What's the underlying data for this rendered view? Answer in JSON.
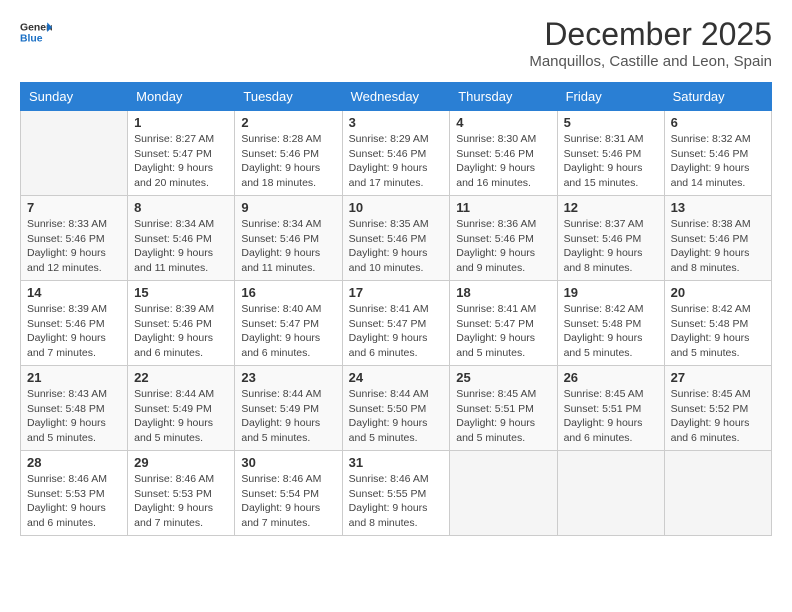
{
  "logo": {
    "general": "General",
    "blue": "Blue"
  },
  "title": "December 2025",
  "subtitle": "Manquillos, Castille and Leon, Spain",
  "days_of_week": [
    "Sunday",
    "Monday",
    "Tuesday",
    "Wednesday",
    "Thursday",
    "Friday",
    "Saturday"
  ],
  "weeks": [
    [
      {
        "day": "",
        "sunrise": "",
        "sunset": "",
        "daylight": ""
      },
      {
        "day": "1",
        "sunrise": "Sunrise: 8:27 AM",
        "sunset": "Sunset: 5:47 PM",
        "daylight": "Daylight: 9 hours and 20 minutes."
      },
      {
        "day": "2",
        "sunrise": "Sunrise: 8:28 AM",
        "sunset": "Sunset: 5:46 PM",
        "daylight": "Daylight: 9 hours and 18 minutes."
      },
      {
        "day": "3",
        "sunrise": "Sunrise: 8:29 AM",
        "sunset": "Sunset: 5:46 PM",
        "daylight": "Daylight: 9 hours and 17 minutes."
      },
      {
        "day": "4",
        "sunrise": "Sunrise: 8:30 AM",
        "sunset": "Sunset: 5:46 PM",
        "daylight": "Daylight: 9 hours and 16 minutes."
      },
      {
        "day": "5",
        "sunrise": "Sunrise: 8:31 AM",
        "sunset": "Sunset: 5:46 PM",
        "daylight": "Daylight: 9 hours and 15 minutes."
      },
      {
        "day": "6",
        "sunrise": "Sunrise: 8:32 AM",
        "sunset": "Sunset: 5:46 PM",
        "daylight": "Daylight: 9 hours and 14 minutes."
      }
    ],
    [
      {
        "day": "7",
        "sunrise": "Sunrise: 8:33 AM",
        "sunset": "Sunset: 5:46 PM",
        "daylight": "Daylight: 9 hours and 12 minutes."
      },
      {
        "day": "8",
        "sunrise": "Sunrise: 8:34 AM",
        "sunset": "Sunset: 5:46 PM",
        "daylight": "Daylight: 9 hours and 11 minutes."
      },
      {
        "day": "9",
        "sunrise": "Sunrise: 8:34 AM",
        "sunset": "Sunset: 5:46 PM",
        "daylight": "Daylight: 9 hours and 11 minutes."
      },
      {
        "day": "10",
        "sunrise": "Sunrise: 8:35 AM",
        "sunset": "Sunset: 5:46 PM",
        "daylight": "Daylight: 9 hours and 10 minutes."
      },
      {
        "day": "11",
        "sunrise": "Sunrise: 8:36 AM",
        "sunset": "Sunset: 5:46 PM",
        "daylight": "Daylight: 9 hours and 9 minutes."
      },
      {
        "day": "12",
        "sunrise": "Sunrise: 8:37 AM",
        "sunset": "Sunset: 5:46 PM",
        "daylight": "Daylight: 9 hours and 8 minutes."
      },
      {
        "day": "13",
        "sunrise": "Sunrise: 8:38 AM",
        "sunset": "Sunset: 5:46 PM",
        "daylight": "Daylight: 9 hours and 8 minutes."
      }
    ],
    [
      {
        "day": "14",
        "sunrise": "Sunrise: 8:39 AM",
        "sunset": "Sunset: 5:46 PM",
        "daylight": "Daylight: 9 hours and 7 minutes."
      },
      {
        "day": "15",
        "sunrise": "Sunrise: 8:39 AM",
        "sunset": "Sunset: 5:46 PM",
        "daylight": "Daylight: 9 hours and 6 minutes."
      },
      {
        "day": "16",
        "sunrise": "Sunrise: 8:40 AM",
        "sunset": "Sunset: 5:47 PM",
        "daylight": "Daylight: 9 hours and 6 minutes."
      },
      {
        "day": "17",
        "sunrise": "Sunrise: 8:41 AM",
        "sunset": "Sunset: 5:47 PM",
        "daylight": "Daylight: 9 hours and 6 minutes."
      },
      {
        "day": "18",
        "sunrise": "Sunrise: 8:41 AM",
        "sunset": "Sunset: 5:47 PM",
        "daylight": "Daylight: 9 hours and 5 minutes."
      },
      {
        "day": "19",
        "sunrise": "Sunrise: 8:42 AM",
        "sunset": "Sunset: 5:48 PM",
        "daylight": "Daylight: 9 hours and 5 minutes."
      },
      {
        "day": "20",
        "sunrise": "Sunrise: 8:42 AM",
        "sunset": "Sunset: 5:48 PM",
        "daylight": "Daylight: 9 hours and 5 minutes."
      }
    ],
    [
      {
        "day": "21",
        "sunrise": "Sunrise: 8:43 AM",
        "sunset": "Sunset: 5:48 PM",
        "daylight": "Daylight: 9 hours and 5 minutes."
      },
      {
        "day": "22",
        "sunrise": "Sunrise: 8:44 AM",
        "sunset": "Sunset: 5:49 PM",
        "daylight": "Daylight: 9 hours and 5 minutes."
      },
      {
        "day": "23",
        "sunrise": "Sunrise: 8:44 AM",
        "sunset": "Sunset: 5:49 PM",
        "daylight": "Daylight: 9 hours and 5 minutes."
      },
      {
        "day": "24",
        "sunrise": "Sunrise: 8:44 AM",
        "sunset": "Sunset: 5:50 PM",
        "daylight": "Daylight: 9 hours and 5 minutes."
      },
      {
        "day": "25",
        "sunrise": "Sunrise: 8:45 AM",
        "sunset": "Sunset: 5:51 PM",
        "daylight": "Daylight: 9 hours and 5 minutes."
      },
      {
        "day": "26",
        "sunrise": "Sunrise: 8:45 AM",
        "sunset": "Sunset: 5:51 PM",
        "daylight": "Daylight: 9 hours and 6 minutes."
      },
      {
        "day": "27",
        "sunrise": "Sunrise: 8:45 AM",
        "sunset": "Sunset: 5:52 PM",
        "daylight": "Daylight: 9 hours and 6 minutes."
      }
    ],
    [
      {
        "day": "28",
        "sunrise": "Sunrise: 8:46 AM",
        "sunset": "Sunset: 5:53 PM",
        "daylight": "Daylight: 9 hours and 6 minutes."
      },
      {
        "day": "29",
        "sunrise": "Sunrise: 8:46 AM",
        "sunset": "Sunset: 5:53 PM",
        "daylight": "Daylight: 9 hours and 7 minutes."
      },
      {
        "day": "30",
        "sunrise": "Sunrise: 8:46 AM",
        "sunset": "Sunset: 5:54 PM",
        "daylight": "Daylight: 9 hours and 7 minutes."
      },
      {
        "day": "31",
        "sunrise": "Sunrise: 8:46 AM",
        "sunset": "Sunset: 5:55 PM",
        "daylight": "Daylight: 9 hours and 8 minutes."
      },
      {
        "day": "",
        "sunrise": "",
        "sunset": "",
        "daylight": ""
      },
      {
        "day": "",
        "sunrise": "",
        "sunset": "",
        "daylight": ""
      },
      {
        "day": "",
        "sunrise": "",
        "sunset": "",
        "daylight": ""
      }
    ]
  ]
}
